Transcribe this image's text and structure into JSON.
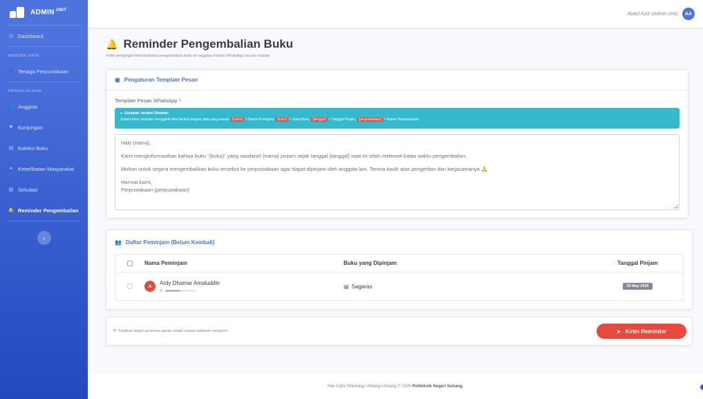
{
  "brand": {
    "name": "ADMIN",
    "suffix": "UNIT"
  },
  "user": {
    "name": "Abdul Aziz (Admin Unit)",
    "initials": "AA"
  },
  "sidebar": {
    "items": [
      {
        "label": "Dashboard",
        "icon": "dashboard-icon"
      },
      {
        "section": "MASTER DATA"
      },
      {
        "label": "Tenaga Perpustakaan",
        "icon": "user-icon"
      },
      {
        "section": "PENGELOLAAN"
      },
      {
        "label": "Anggota",
        "icon": "users-icon"
      },
      {
        "label": "Kunjungan",
        "icon": "visit-icon"
      },
      {
        "label": "Koleksi Buku",
        "icon": "book-icon"
      },
      {
        "label": "Keterlibatan Masyarakat",
        "icon": "community-icon"
      },
      {
        "label": "Sirkulasi",
        "icon": "circulation-icon"
      },
      {
        "label": "Reminder Pengembalian",
        "icon": "bell-icon",
        "active": true
      }
    ]
  },
  "page": {
    "title": "Reminder Pengembalian Buku",
    "subtitle": "Kirim pengingat keterlambatan pengembalian buku ke anggota melalui WhatsApp secara massal."
  },
  "template_card": {
    "header": "Pengaturan Template Pesan",
    "field_label": "Template Pesan WhatsApp",
    "required_mark": "*",
    "alert_title": "Gunakan Variabel Dinamis:",
    "alert_text_prefix": "Sistem akan otomatis mengganti teks berikut dengan data yang sesuai:",
    "variables": [
      {
        "tag": "{nama}",
        "desc": "= Nama Peminjam,"
      },
      {
        "tag": "{buku}",
        "desc": "= Judul Buku,"
      },
      {
        "tag": "{tanggal}",
        "desc": "= Tanggal Pinjam,"
      },
      {
        "tag": "{perpustakaan}",
        "desc": "= Nama Perpustakaan"
      }
    ],
    "message": {
      "line1": "Halo {nama},",
      "line2": "Kami menginformasikan bahwa buku \"{buku}\" yang saudara/i {nama} pinjam sejak tanggal {tanggal} saat ini telah melewati batas waktu pengembalian.",
      "line3": "Mohon untuk segera mengembalikan buku tersebut ke perpustakaan agar dapat dipinjam oleh anggota lain. Terima kasih atas pengertian dan kerjasamanya 🙏",
      "line4": "Hormat kami,",
      "line5": "Perpustakaan {perpustakaan}"
    }
  },
  "borrowers_card": {
    "header": "Daftar Peminjam (Belum Kembali)",
    "columns": {
      "name": "Nama Peminjam",
      "book": "Buku yang Dipinjam",
      "date": "Tanggal Pinjam"
    },
    "rows": [
      {
        "initial": "A",
        "name": "Ardy Dhamar Amaluddin",
        "book": "Sagaras",
        "date": "03 May 2026"
      }
    ]
  },
  "action_card": {
    "hint": "Pastikan target penerima pesan sudah sesuai sebelum mengirim.",
    "send_label": "Kirim Reminder"
  },
  "footer": {
    "text": "Hak Cipta Dilindungi Undang-Undang © 2026",
    "org": "Politeknik Negeri Subang."
  },
  "colors": {
    "primary": "#4e73df",
    "danger": "#e74a3b",
    "info": "#36b9cc"
  }
}
